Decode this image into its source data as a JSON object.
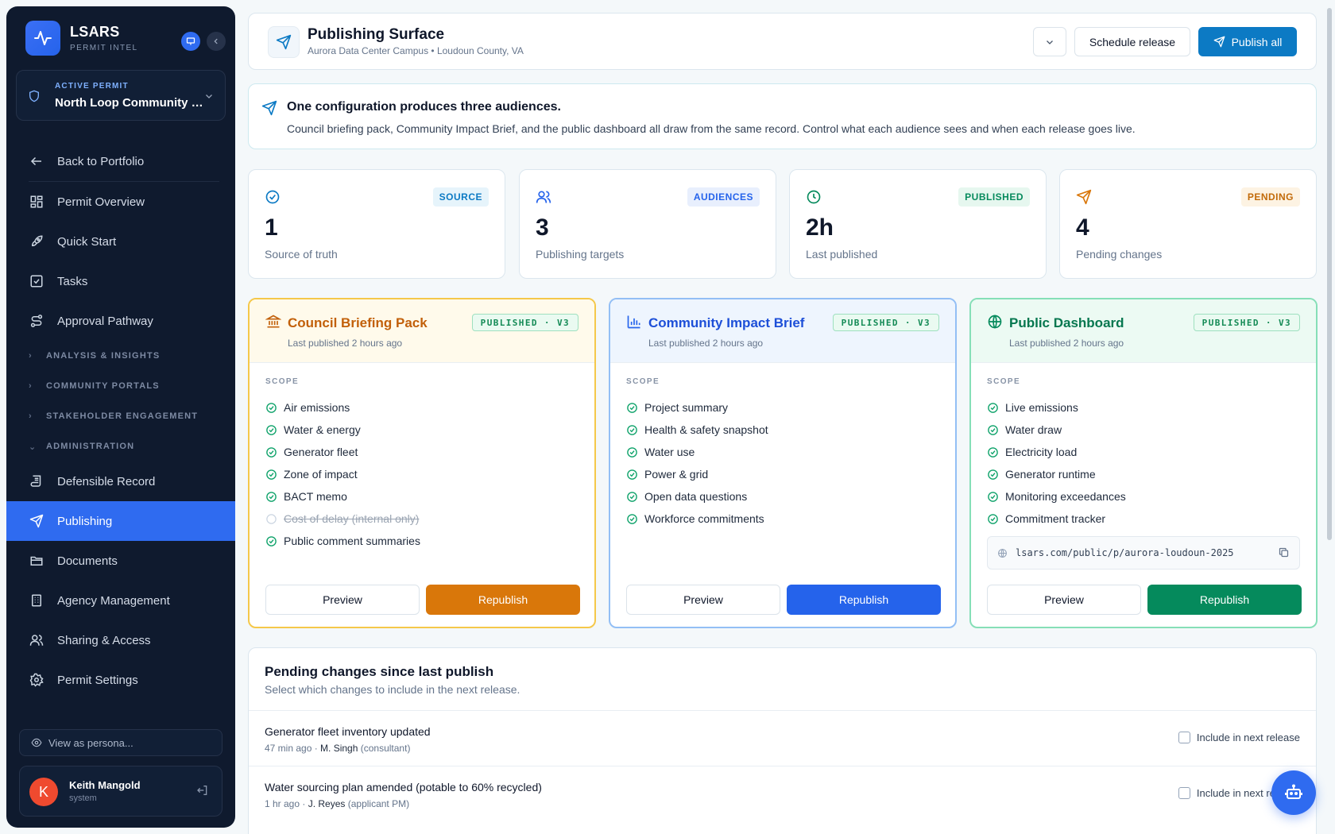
{
  "brand": {
    "name": "LSARS",
    "sub": "PERMIT INTEL"
  },
  "permit": {
    "label": "ACTIVE PERMIT",
    "name": "North Loop Community M..."
  },
  "nav": {
    "back": "Back to Portfolio",
    "overview": "Permit Overview",
    "quickstart": "Quick Start",
    "tasks": "Tasks",
    "approval": "Approval Pathway",
    "group_analysis": "ANALYSIS & INSIGHTS",
    "group_portals": "COMMUNITY PORTALS",
    "group_stakeholder": "STAKEHOLDER ENGAGEMENT",
    "group_admin": "ADMINISTRATION",
    "record": "Defensible Record",
    "publishing": "Publishing",
    "documents": "Documents",
    "agency": "Agency Management",
    "sharing": "Sharing & Access",
    "settings": "Permit Settings"
  },
  "persona": {
    "label": "View as persona..."
  },
  "user": {
    "initial": "K",
    "name": "Keith Mangold",
    "role": "system"
  },
  "header": {
    "title": "Publishing Surface",
    "subtitle": "Aurora Data Center Campus • Loudoun County, VA",
    "schedule": "Schedule release",
    "publish_all": "Publish all"
  },
  "banner": {
    "title": "One configuration produces three audiences.",
    "text": "Council briefing pack, Community Impact Brief, and the public dashboard all draw from the same record. Control what each audience sees and when each release goes live."
  },
  "stats": [
    {
      "badge": "SOURCE",
      "value": "1",
      "label": "Source of truth"
    },
    {
      "badge": "AUDIENCES",
      "value": "3",
      "label": "Publishing targets"
    },
    {
      "badge": "PUBLISHED",
      "value": "2h",
      "label": "Last published"
    },
    {
      "badge": "PENDING",
      "value": "4",
      "label": "Pending changes"
    }
  ],
  "colors": {
    "orange": "#d9770a",
    "blue": "#2563eb",
    "green": "#058a5c",
    "accent": "#0c7ac4"
  },
  "pubs": [
    {
      "title": "Council Briefing Pack",
      "sub": "Last published 2 hours ago",
      "badge": "PUBLISHED · V3",
      "scope_label": "SCOPE",
      "items": [
        "Air emissions",
        "Water & energy",
        "Generator fleet",
        "Zone of impact",
        "BACT memo",
        "Cost of delay (internal only)",
        "Public comment summaries"
      ],
      "preview": "Preview",
      "republish": "Republish"
    },
    {
      "title": "Community Impact Brief",
      "sub": "Last published 2 hours ago",
      "badge": "PUBLISHED · V3",
      "scope_label": "SCOPE",
      "items": [
        "Project summary",
        "Health & safety snapshot",
        "Water use",
        "Power & grid",
        "Open data questions",
        "Workforce commitments"
      ],
      "preview": "Preview",
      "republish": "Republish"
    },
    {
      "title": "Public Dashboard",
      "sub": "Last published 2 hours ago",
      "badge": "PUBLISHED · V3",
      "scope_label": "SCOPE",
      "items": [
        "Live emissions",
        "Water draw",
        "Electricity load",
        "Generator runtime",
        "Monitoring exceedances",
        "Commitment tracker"
      ],
      "url": "lsars.com/public/p/aurora-loudoun-2025",
      "preview": "Preview",
      "republish": "Republish"
    }
  ],
  "pending": {
    "title": "Pending changes since last publish",
    "subtitle": "Select which changes to include in the next release.",
    "rows": [
      {
        "title": "Generator fleet inventory updated",
        "time": "47 min ago · ",
        "who": "M. Singh",
        "role": " (consultant)",
        "check": "Include in next release"
      },
      {
        "title": "Water sourcing plan amended (potable to 60% recycled)",
        "time": "1 hr ago · ",
        "who": "J. Reyes",
        "role": " (applicant PM)",
        "check": "Include in next release"
      }
    ]
  }
}
